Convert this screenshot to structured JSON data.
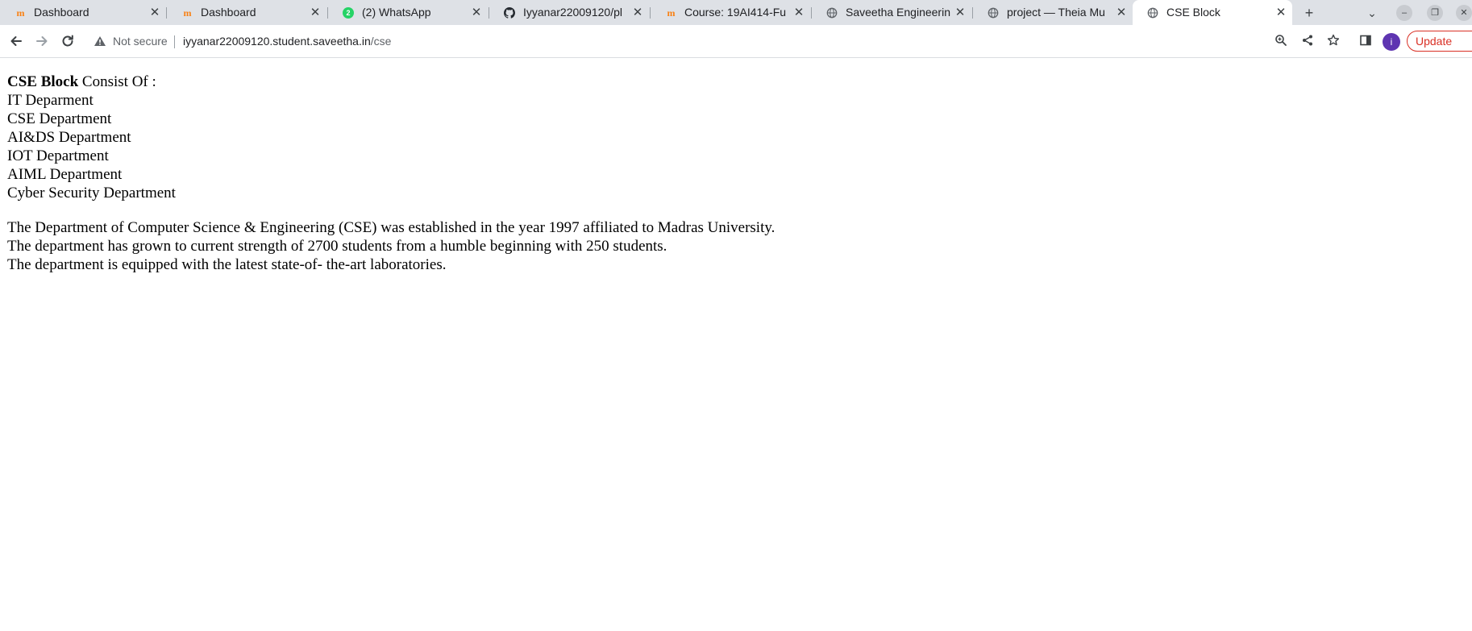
{
  "browser": {
    "tabs": [
      {
        "title": "Dashboard",
        "icon": "moodle-icon"
      },
      {
        "title": "Dashboard",
        "icon": "moodle-icon"
      },
      {
        "title": "(2) WhatsApp",
        "icon": "whatsapp-icon",
        "badge": "2"
      },
      {
        "title": "Iyyanar22009120/pl",
        "icon": "github-icon"
      },
      {
        "title": "Course: 19AI414-Fu",
        "icon": "moodle-icon"
      },
      {
        "title": "Saveetha Engineerin",
        "icon": "globe-icon"
      },
      {
        "title": "project — Theia Mu",
        "icon": "globe-icon"
      },
      {
        "title": "CSE Block",
        "icon": "globe-icon",
        "active": true
      }
    ],
    "new_tab_label": "+",
    "security_label": "Not secure",
    "url_host": "iyyanar22009120.student.saveetha.in",
    "url_path": "/cse",
    "avatar_letter": "i",
    "update_label": "Update"
  },
  "page": {
    "heading_bold": "CSE Block",
    "heading_rest": " Consist Of :",
    "departments": [
      "IT Deparment",
      "CSE Department",
      "AI&DS Department",
      "IOT Department",
      "AIML Department",
      "Cyber Security Department"
    ],
    "description": [
      "The Department of Computer Science & Engineering (CSE) was established in the year 1997 affiliated to Madras University.",
      "The department has grown to current strength of 2700 students from a humble beginning with 250 students.",
      "The department is equipped with the latest state-of- the-art laboratories."
    ]
  },
  "colors": {
    "tabstrip_bg": "#dee1e6",
    "update_accent": "#d93025",
    "avatar_bg": "#5e35b1"
  }
}
